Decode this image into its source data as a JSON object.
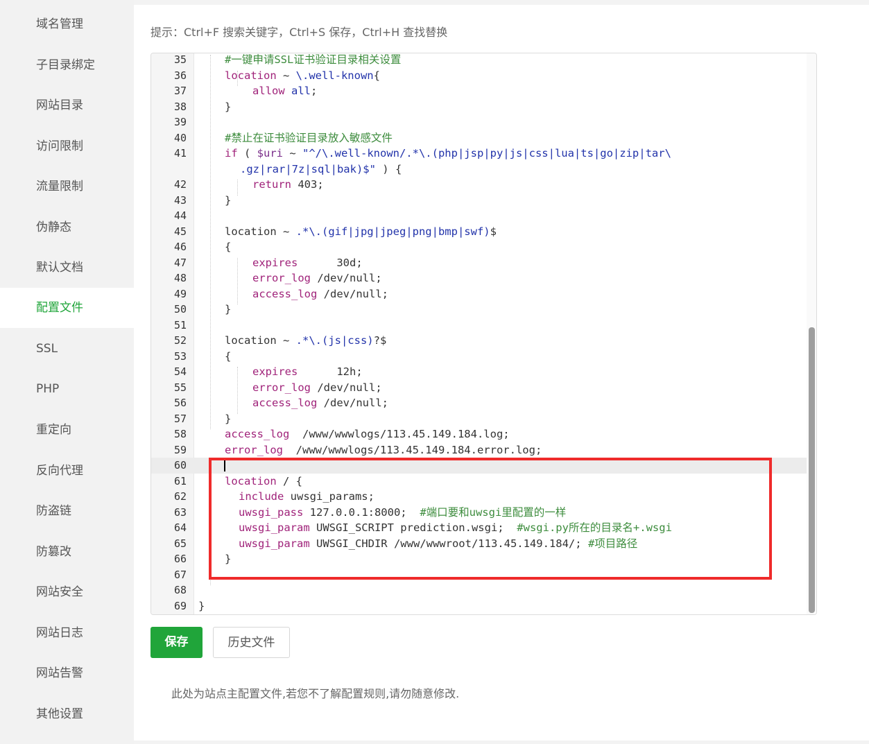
{
  "sidebar": {
    "items": [
      {
        "label": "域名管理"
      },
      {
        "label": "子目录绑定"
      },
      {
        "label": "网站目录"
      },
      {
        "label": "访问限制"
      },
      {
        "label": "流量限制"
      },
      {
        "label": "伪静态"
      },
      {
        "label": "默认文档"
      },
      {
        "label": "配置文件",
        "active": true
      },
      {
        "label": "SSL"
      },
      {
        "label": "PHP"
      },
      {
        "label": "重定向"
      },
      {
        "label": "反向代理"
      },
      {
        "label": "防盗链"
      },
      {
        "label": "防篡改"
      },
      {
        "label": "网站安全"
      },
      {
        "label": "网站日志"
      },
      {
        "label": "网站告警"
      },
      {
        "label": "其他设置"
      }
    ]
  },
  "editor": {
    "hint": "提示：Ctrl+F 搜索关键字，Ctrl+S 保存，Ctrl+H 查找替换",
    "current_line": "60",
    "lines": [
      {
        "n": "35",
        "tokens": [
          [
            "com",
            "#一键申请SSL证书验证目录相关设置"
          ]
        ]
      },
      {
        "n": "36",
        "tokens": [
          [
            "kw",
            "location"
          ],
          [
            "p",
            " ~ "
          ],
          [
            "val",
            "\\.well-known"
          ],
          [
            "p",
            "{"
          ]
        ]
      },
      {
        "n": "37",
        "tokens": [
          [
            "kw",
            "allow"
          ],
          [
            "p",
            " "
          ],
          [
            "val",
            "all"
          ],
          [
            "p",
            ";"
          ]
        ]
      },
      {
        "n": "38",
        "tokens": [
          [
            "p",
            "}"
          ]
        ]
      },
      {
        "n": "39",
        "tokens": []
      },
      {
        "n": "40",
        "tokens": [
          [
            "com",
            "#禁止在证书验证目录放入敏感文件"
          ]
        ]
      },
      {
        "n": "41",
        "tokens": [
          [
            "kw",
            "if"
          ],
          [
            "p",
            " ( "
          ],
          [
            "var",
            "$uri"
          ],
          [
            "p",
            " ~ "
          ],
          [
            "str",
            "\"^/\\.well-known/.*\\.(php|jsp|py|js|css|lua|ts|go|zip|tar\\"
          ]
        ]
      },
      {
        "n": "",
        "tokens": [
          [
            "str",
            ".gz|rar|7z|sql|bak)$\""
          ],
          [
            "p",
            " ) {"
          ]
        ]
      },
      {
        "n": "42",
        "tokens": [
          [
            "kw",
            "return"
          ],
          [
            "p",
            " 403;"
          ]
        ]
      },
      {
        "n": "43",
        "tokens": [
          [
            "p",
            "}"
          ]
        ]
      },
      {
        "n": "44",
        "tokens": []
      },
      {
        "n": "45",
        "tokens": [
          [
            "p",
            "location ~ "
          ],
          [
            "val",
            ".*\\.(gif|jpg|jpeg|png|bmp|swf)"
          ],
          [
            "p",
            "$"
          ]
        ]
      },
      {
        "n": "46",
        "tokens": [
          [
            "p",
            "{"
          ]
        ]
      },
      {
        "n": "47",
        "tokens": [
          [
            "kw",
            "expires"
          ],
          [
            "p",
            "      30d;"
          ]
        ]
      },
      {
        "n": "48",
        "tokens": [
          [
            "kw",
            "error_log"
          ],
          [
            "p",
            " /dev/null;"
          ]
        ]
      },
      {
        "n": "49",
        "tokens": [
          [
            "kw",
            "access_log"
          ],
          [
            "p",
            " /dev/null;"
          ]
        ]
      },
      {
        "n": "50",
        "tokens": [
          [
            "p",
            "}"
          ]
        ]
      },
      {
        "n": "51",
        "tokens": []
      },
      {
        "n": "52",
        "tokens": [
          [
            "p",
            "location ~ "
          ],
          [
            "val",
            ".*\\.(js|css)"
          ],
          [
            "p",
            "?$"
          ]
        ]
      },
      {
        "n": "53",
        "tokens": [
          [
            "p",
            "{"
          ]
        ]
      },
      {
        "n": "54",
        "tokens": [
          [
            "kw",
            "expires"
          ],
          [
            "p",
            "      12h;"
          ]
        ]
      },
      {
        "n": "55",
        "tokens": [
          [
            "kw",
            "error_log"
          ],
          [
            "p",
            " /dev/null;"
          ]
        ]
      },
      {
        "n": "56",
        "tokens": [
          [
            "kw",
            "access_log"
          ],
          [
            "p",
            " /dev/null;"
          ]
        ]
      },
      {
        "n": "57",
        "tokens": [
          [
            "p",
            "}"
          ]
        ]
      },
      {
        "n": "58",
        "tokens": [
          [
            "kw",
            "access_log"
          ],
          [
            "p",
            "  /www/wwwlogs/113.45.149.184.log;"
          ]
        ]
      },
      {
        "n": "59",
        "tokens": [
          [
            "kw",
            "error_log"
          ],
          [
            "p",
            "  /www/wwwlogs/113.45.149.184.error.log;"
          ]
        ]
      },
      {
        "n": "60",
        "tokens": []
      },
      {
        "n": "61",
        "tokens": [
          [
            "kw",
            "location"
          ],
          [
            "p",
            " / {"
          ]
        ]
      },
      {
        "n": "62",
        "tokens": [
          [
            "kw",
            "include"
          ],
          [
            "p",
            " uwsgi_params;"
          ]
        ]
      },
      {
        "n": "63",
        "tokens": [
          [
            "kw",
            "uwsgi_pass"
          ],
          [
            "p",
            " 127.0.0.1:8000;  "
          ],
          [
            "com",
            "#端口要和uwsgi里配置的一样"
          ]
        ]
      },
      {
        "n": "64",
        "tokens": [
          [
            "kw",
            "uwsgi_param"
          ],
          [
            "p",
            " UWSGI_SCRIPT prediction.wsgi;  "
          ],
          [
            "com",
            "#wsgi.py所在的目录名+.wsgi"
          ]
        ]
      },
      {
        "n": "65",
        "tokens": [
          [
            "kw",
            "uwsgi_param"
          ],
          [
            "p",
            " UWSGI_CHDIR /www/wwwroot/113.45.149.184/; "
          ],
          [
            "com",
            "#项目路径"
          ]
        ]
      },
      {
        "n": "66",
        "tokens": [
          [
            "p",
            "}"
          ]
        ]
      },
      {
        "n": "67",
        "tokens": []
      },
      {
        "n": "68",
        "tokens": []
      },
      {
        "n": "69",
        "tokens": [
          [
            "p",
            "}"
          ]
        ]
      }
    ]
  },
  "buttons": {
    "save_label": "保存",
    "history_label": "历史文件"
  },
  "footer_note": "此处为站点主配置文件,若您不了解配置规则,请勿随意修改.",
  "colors": {
    "accent": "#20a53a",
    "highlight_box": "#ef2b2b"
  }
}
